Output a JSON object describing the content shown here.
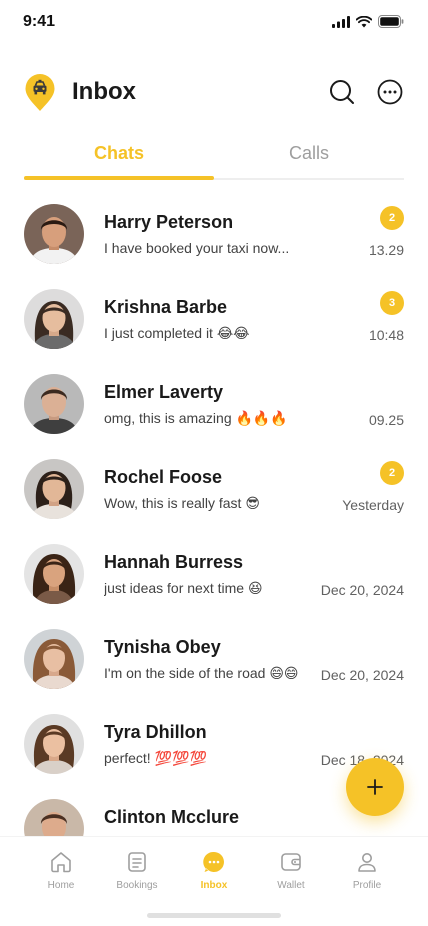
{
  "status_bar": {
    "time": "9:41"
  },
  "header": {
    "title": "Inbox",
    "logo_icon": "taxi-icon",
    "search_icon": "search-icon",
    "more_icon": "more-icon"
  },
  "tabs": [
    {
      "label": "Chats",
      "active": true
    },
    {
      "label": "Calls",
      "active": false
    }
  ],
  "colors": {
    "accent": "#F5C227",
    "text": "#1a1a1a",
    "muted": "#9e9e9e"
  },
  "chats": [
    {
      "name": "Harry Peterson",
      "message": "I have booked your taxi now...",
      "time": "13.29",
      "unread": "2"
    },
    {
      "name": "Krishna Barbe",
      "message": "I just completed it 😂😂",
      "time": "10:48",
      "unread": "3"
    },
    {
      "name": "Elmer Laverty",
      "message": "omg, this is amazing 🔥🔥🔥",
      "time": "09.25",
      "unread": null
    },
    {
      "name": "Rochel Foose",
      "message": "Wow, this is really fast 😎",
      "time": "Yesterday",
      "unread": "2"
    },
    {
      "name": "Hannah Burress",
      "message": "just ideas for next time 😆",
      "time": "Dec 20, 2024",
      "unread": null
    },
    {
      "name": "Tynisha Obey",
      "message": "I'm on the side of the road 😄😄",
      "time": "Dec 20, 2024",
      "unread": null
    },
    {
      "name": "Tyra Dhillon",
      "message": "perfect! 💯💯💯",
      "time": "Dec 18, 2024",
      "unread": null
    },
    {
      "name": "Clinton Mcclure",
      "message": "",
      "time": "",
      "unread": null
    }
  ],
  "fab": {
    "icon": "plus-icon"
  },
  "bottom_nav": [
    {
      "label": "Home",
      "icon": "home-icon",
      "active": false
    },
    {
      "label": "Bookings",
      "icon": "bookings-icon",
      "active": false
    },
    {
      "label": "Inbox",
      "icon": "inbox-icon",
      "active": true
    },
    {
      "label": "Wallet",
      "icon": "wallet-icon",
      "active": false
    },
    {
      "label": "Profile",
      "icon": "profile-icon",
      "active": false
    }
  ]
}
